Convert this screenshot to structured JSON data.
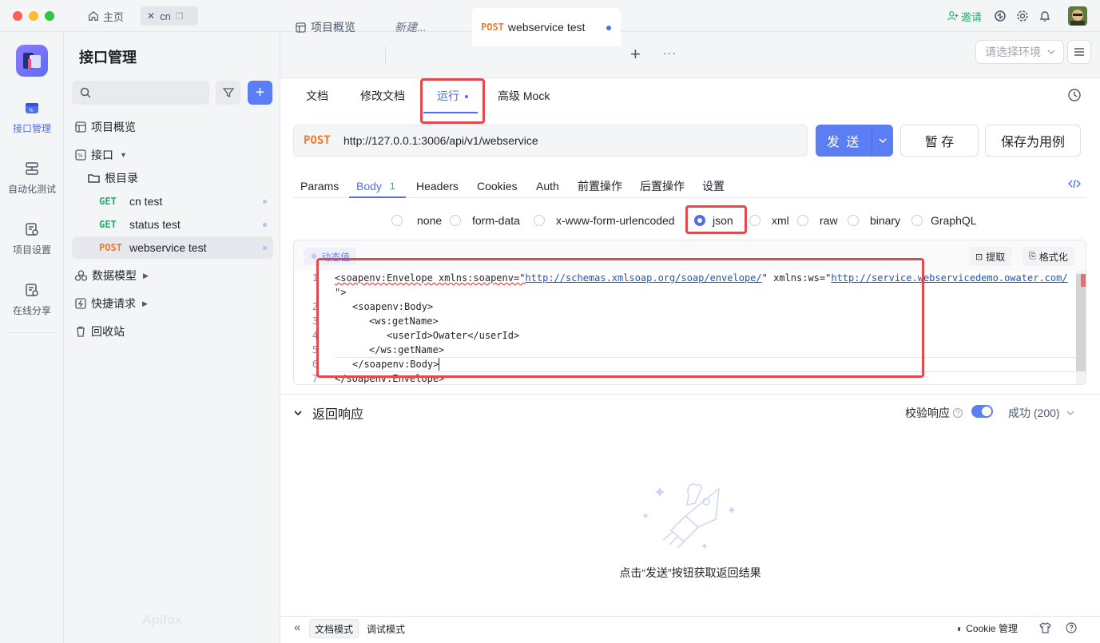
{
  "titlebar": {
    "home_label": "主页",
    "project_tab": "cn",
    "invite_label": "邀请"
  },
  "rail": {
    "items": [
      {
        "label": "接口管理",
        "icon": "api-management-icon"
      },
      {
        "label": "自动化测试",
        "icon": "automation-test-icon"
      },
      {
        "label": "项目设置",
        "icon": "project-settings-icon"
      },
      {
        "label": "在线分享",
        "icon": "online-share-icon"
      }
    ]
  },
  "sidebar": {
    "title": "接口管理",
    "search_placeholder": "",
    "overview": "项目概览",
    "interfaces": "接口",
    "root_folder": "根目录",
    "endpoints": [
      {
        "method": "GET",
        "name": "cn test"
      },
      {
        "method": "GET",
        "name": "status test"
      },
      {
        "method": "POST",
        "name": "webservice test"
      }
    ],
    "data_models": "数据模型",
    "quick_requests": "快捷请求",
    "recycle_bin": "回收站",
    "watermark": "Apifox"
  },
  "doc_tabs": {
    "overview": "项目概览",
    "new": "新建...",
    "active_method": "POST",
    "active_name": "webservice test",
    "env_placeholder": "请选择环境"
  },
  "mode_tabs": {
    "doc": "文档",
    "edit_doc": "修改文档",
    "run": "运行",
    "mock": "高级 Mock"
  },
  "request": {
    "method": "POST",
    "url": "http://127.0.0.1:3006/api/v1/webservice",
    "send": "发 送",
    "save_temp": "暂 存",
    "save_case": "保存为用例"
  },
  "param_tabs": {
    "params": "Params",
    "body": "Body",
    "body_count": "1",
    "headers": "Headers",
    "cookies": "Cookies",
    "auth": "Auth",
    "pre": "前置操作",
    "post": "后置操作",
    "settings": "设置"
  },
  "body_types": [
    "none",
    "form-data",
    "x-www-form-urlencoded",
    "json",
    "xml",
    "raw",
    "binary",
    "GraphQL"
  ],
  "body_selected": "json",
  "editor": {
    "dynamic_value": "动态值",
    "extract": "提取",
    "format": "格式化",
    "line_numbers": [
      "1",
      "",
      "2",
      "3",
      "4",
      "5",
      "6",
      "7"
    ],
    "line1_a": "<soapenv:Envelope xmlns:soapenv=\"",
    "line1_url1": "http://schemas.xmlsoap.org/soap/envelope/",
    "line1_b": "\" xmlns:ws=\"",
    "line1_url2": "http://service.webservicedemo.owater.com/",
    "line1_wrap": "\">",
    "line2": "<soapenv:Body>",
    "line3": "<ws:getName>",
    "line4": "<userId>Owater</userId>",
    "line5": "</ws:getName>",
    "line6": "</soapenv:Body>",
    "line7": "</soapenv:Envelope>"
  },
  "response": {
    "title": "返回响应",
    "validate": "校验响应",
    "status": "成功 (200)",
    "empty_hint": "点击“发送”按钮获取返回结果"
  },
  "footer": {
    "doc_mode": "文档模式",
    "debug_mode": "调试模式",
    "cookie": "Cookie 管理"
  }
}
